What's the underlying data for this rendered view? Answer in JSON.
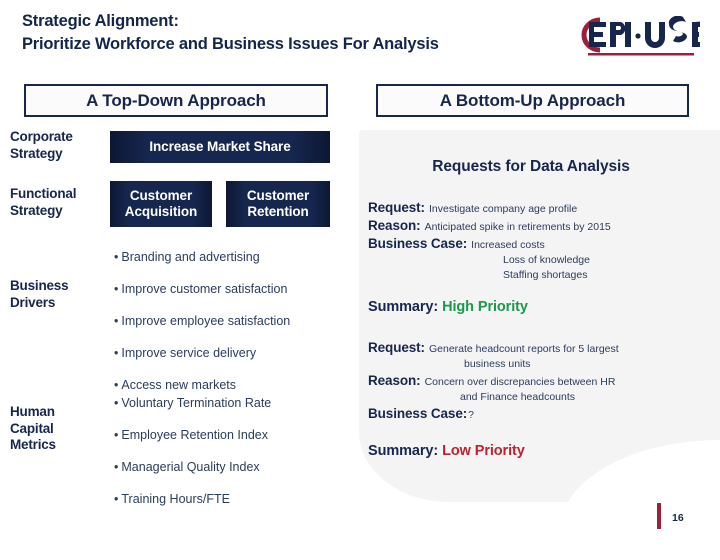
{
  "header": {
    "title_line1": "Strategic Alignment:",
    "title_line2": "Prioritize Workforce and Business Issues For Analysis",
    "logo_text": "EPI·USE",
    "logo_mark": "®"
  },
  "colors": {
    "navy": "#17264d",
    "navy_dark": "#0c1733",
    "maroon": "#9e1f38",
    "panel": "#f4f4f5",
    "high_priority": "#1a9a4a",
    "low_priority": "#c0202a",
    "body_text": "#2b3c5c"
  },
  "left_column": {
    "title": "A Top-Down Approach",
    "rows": [
      {
        "label": "Corporate\nStrategy",
        "label_line1": "Corporate",
        "label_line2": "Strategy",
        "boxes": [
          "Increase Market Share"
        ]
      },
      {
        "label_line1": "Functional",
        "label_line2": "Strategy",
        "boxes": [
          "Customer Acquisition",
          "Customer Retention"
        ]
      },
      {
        "label_line1": "Business",
        "label_line2": "Drivers",
        "bullets": [
          "Branding and advertising",
          "Improve customer satisfaction",
          "Improve employee satisfaction",
          "Improve service delivery",
          "Access new markets"
        ]
      },
      {
        "label_line1": "Human",
        "label_line2": "Capital",
        "label_line3": "Metrics",
        "bullets": [
          "Voluntary Termination Rate",
          "Employee Retention Index",
          "Managerial Quality Index",
          "Training Hours/FTE"
        ]
      }
    ],
    "box_labels": {
      "market_share": "Increase Market Share",
      "customer_acquisition_l1": "Customer",
      "customer_acquisition_l2": "Acquisition",
      "customer_retention_l1": "Customer",
      "customer_retention_l2": "Retention"
    },
    "bullet_marker": "•"
  },
  "right_column": {
    "title": "A Bottom-Up Approach",
    "heading": "Requests for Data Analysis",
    "requests": [
      {
        "request_key": "Request:",
        "request_value": "Investigate company age profile",
        "reason_key": "Reason:",
        "reason_value": "Anticipated spike in retirements by 2015",
        "business_case_key": "Business Case:",
        "business_case_value": "Increased costs",
        "business_case_extra_1": "Loss of knowledge",
        "business_case_extra_2": "Staffing shortages",
        "summary_key": "Summary:",
        "summary_value": "High Priority",
        "summary_color": "#1a9a4a"
      },
      {
        "request_key": "Request:",
        "request_value": "Generate headcount reports for 5 largest",
        "request_value_line2": "business units",
        "reason_key": "Reason:",
        "reason_value": "Concern over discrepancies between HR",
        "reason_value_line2": "and Finance headcounts",
        "business_case_key": "Business Case:",
        "business_case_value": "?",
        "summary_key": "Summary:",
        "summary_value": "Low Priority",
        "summary_color": "#c0202a"
      }
    ]
  },
  "footer": {
    "page_number": "16"
  }
}
